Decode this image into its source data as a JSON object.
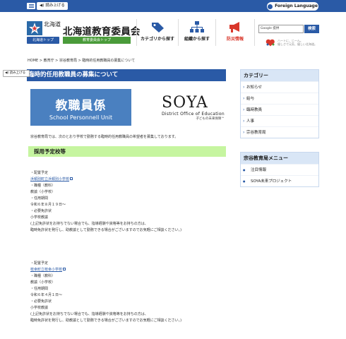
{
  "topbar": {
    "read_aloud": "読み上げる",
    "foreign_language": "Foreign Language"
  },
  "header": {
    "logo_prefecture": "北海道",
    "logo_top_label": "北海道トップ",
    "board_title": "北海道教育委員会",
    "board_top_label": "教育委員会トップ",
    "nav_category": "カテゴリから探す",
    "nav_org": "組織から探す",
    "nav_disaster": "防災情報",
    "search_placeholder": "Google 提供",
    "search_button": "検索",
    "heart_text_line1": "ハートに、じーん。",
    "heart_text_line2": "優しさで元気、優しい北海道。"
  },
  "breadcrumb": {
    "items": [
      "HOME",
      "教育庁",
      "宗谷教育局",
      "臨時的任用教職員の募集について"
    ],
    "separator": ">"
  },
  "page": {
    "read_aloud": "読み上げる",
    "title": "臨時的任用教職員の募集について",
    "hero_main": "教職員係",
    "hero_sub": "School Personnell Unit",
    "soya_name": "SOYA",
    "soya_sub": "District Office of Education",
    "soya_tag": "子どもの未来保障™",
    "intro": "宗谷教育局では、次のとおり学校で勤務する臨時的任用教職員の希望者を募集しております。",
    "section_title": "採用予定校等"
  },
  "jobs": [
    {
      "label_school": "・配置予定",
      "school": "浜頓別町立浜頓別小学校",
      "label_position": "・職種（教科）",
      "position": "教諭（小学校）",
      "label_period": "・任用期間",
      "period": "令和６年８月１９日～",
      "label_license": "・必要免許状",
      "license": "小学校教諭",
      "note1": "(上記免許状をお持ちでない場合でも、指導経験や資格等をお持ちの方は、",
      "note2": "臨時免許状を発行し、助教諭として勤務できる場合がございますのでお気軽にご相談ください。)"
    },
    {
      "label_school": "・配置予定",
      "school": "枝幸町立枝幸小学校",
      "label_position": "・職種（教科）",
      "position": "教諭（小学校）",
      "label_period": "・任用期間",
      "period": "令和６年４月１日～",
      "label_license": "・必要免許状",
      "license": "小学校教諭",
      "note1": "(上記免許状をお持ちでない場合でも、指導経験や資格等をお持ちの方は、",
      "note2": "臨時免許状を発行し、助教諭として勤務できる場合がございますのでお気軽にご相談ください。)"
    }
  ],
  "sidebar": {
    "category_title": "カテゴリー",
    "category_items": [
      "お知らせ",
      "給与",
      "臨時教員",
      "人事",
      "宗谷教育局"
    ],
    "menu_title": "宗谷教育局メニュー",
    "menu_items": [
      "注目情報",
      "SOYA未来プロジェクト"
    ]
  },
  "colors": {
    "primary": "#2a5aa6",
    "green": "#4a9b3a",
    "section_green": "#c6f5a0",
    "hero_blue": "#4a80c0",
    "disaster_red": "#d9372b"
  }
}
